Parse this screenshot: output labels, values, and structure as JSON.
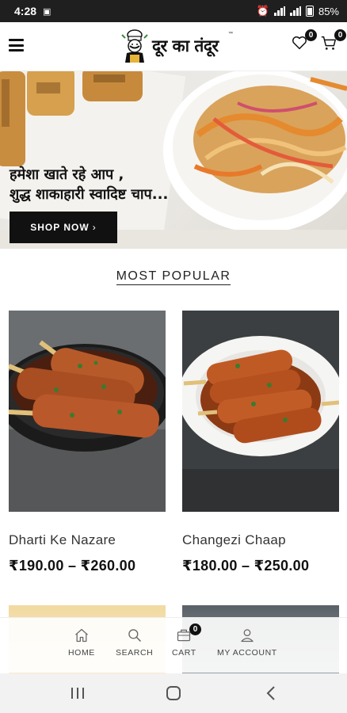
{
  "status_bar": {
    "time": "4:28",
    "battery": "85%"
  },
  "header": {
    "logo_text": "दूर का तंदूर",
    "logo_tm": "™",
    "wishlist_count": "0",
    "cart_count": "0"
  },
  "hero": {
    "line1": "हमेशा खाते रहे आप ,",
    "line2": "शुद्ध शाकाहारी स्वादिष्ट चाप...",
    "button_label": "SHOP NOW",
    "button_arrow": "›"
  },
  "section": {
    "title": "MOST POPULAR"
  },
  "products": [
    {
      "name": "Dharti Ke Nazare",
      "price": "₹190.00 – ₹260.00"
    },
    {
      "name": "Changezi Chaap",
      "price": "₹180.00 – ₹250.00"
    }
  ],
  "bottom_nav": {
    "home": "HOME",
    "search": "SEARCH",
    "cart": "CART",
    "cart_count": "0",
    "account": "MY ACCOUNT"
  },
  "icons": [
    "menu-icon",
    "heart-icon",
    "cart-icon",
    "home-icon",
    "search-icon",
    "briefcase-icon",
    "user-icon",
    "recents-icon",
    "home-circle-icon",
    "back-icon"
  ]
}
